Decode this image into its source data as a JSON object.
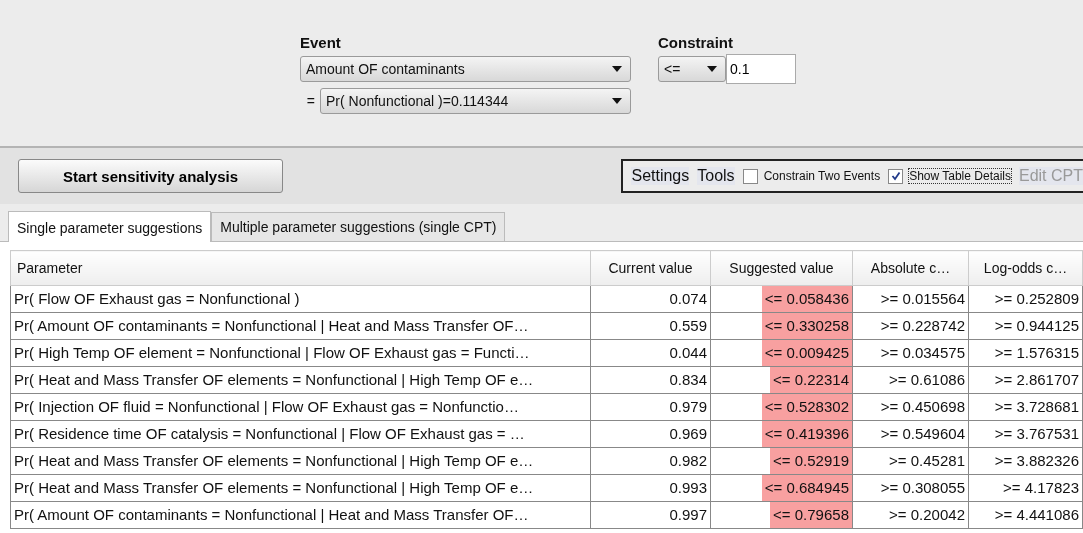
{
  "event": {
    "label": "Event",
    "node": "Amount OF contaminants",
    "equals": "=",
    "state": "Pr( Nonfunctional )=0.114344"
  },
  "constraint": {
    "label": "Constraint",
    "operator": "<=",
    "value": "0.1"
  },
  "start_button": "Start sensitivity analysis",
  "toolbar": {
    "menus": [
      "Settings",
      "Tools"
    ],
    "checks": [
      {
        "label": "Constrain Two Events",
        "checked": false
      },
      {
        "label": "Show Table Details",
        "checked": true
      }
    ],
    "edit": {
      "label": "Edit CPT",
      "disabled": true
    }
  },
  "tabs": [
    {
      "label": "Single parameter suggestions",
      "selected": true
    },
    {
      "label": "Multiple parameter suggestions (single CPT)",
      "selected": false
    }
  ],
  "table": {
    "columns": [
      "Parameter",
      "Current value",
      "Suggested value",
      "Absolute c…",
      "Log-odds c…"
    ],
    "rows": [
      [
        "Pr( Flow OF Exhaust gas = Nonfunctional )",
        "0.074",
        "<= 0.058436",
        ">= 0.015564",
        ">= 0.252809"
      ],
      [
        "Pr( Amount OF contaminants = Nonfunctional | Heat and Mass Transfer OF…",
        "0.559",
        "<= 0.330258",
        ">= 0.228742",
        ">= 0.944125"
      ],
      [
        "Pr( High Temp OF element = Nonfunctional | Flow OF Exhaust gas = Functi…",
        "0.044",
        "<= 0.009425",
        ">= 0.034575",
        ">= 1.576315"
      ],
      [
        "Pr( Heat and Mass Transfer OF elements = Nonfunctional | High Temp OF e…",
        "0.834",
        "<= 0.22314",
        ">= 0.61086",
        ">= 2.861707"
      ],
      [
        "Pr( Injection OF fluid = Nonfunctional | Flow OF Exhaust gas = Nonfunctio…",
        "0.979",
        "<= 0.528302",
        ">= 0.450698",
        ">= 3.728681"
      ],
      [
        "Pr( Residence time OF catalysis = Nonfunctional | Flow OF Exhaust gas = …",
        "0.969",
        "<= 0.419396",
        ">= 0.549604",
        ">= 3.767531"
      ],
      [
        "Pr( Heat and Mass Transfer OF elements = Nonfunctional | High Temp OF e…",
        "0.982",
        "<= 0.52919",
        ">= 0.45281",
        ">= 3.882326"
      ],
      [
        "Pr( Heat and Mass Transfer OF elements = Nonfunctional | High Temp OF e…",
        "0.993",
        "<= 0.684945",
        ">= 0.308055",
        ">= 4.17823"
      ],
      [
        "Pr( Amount OF contaminants = Nonfunctional | Heat and Mass Transfer OF…",
        "0.997",
        "<= 0.79658",
        ">= 0.20042",
        ">= 4.441086"
      ]
    ]
  }
}
